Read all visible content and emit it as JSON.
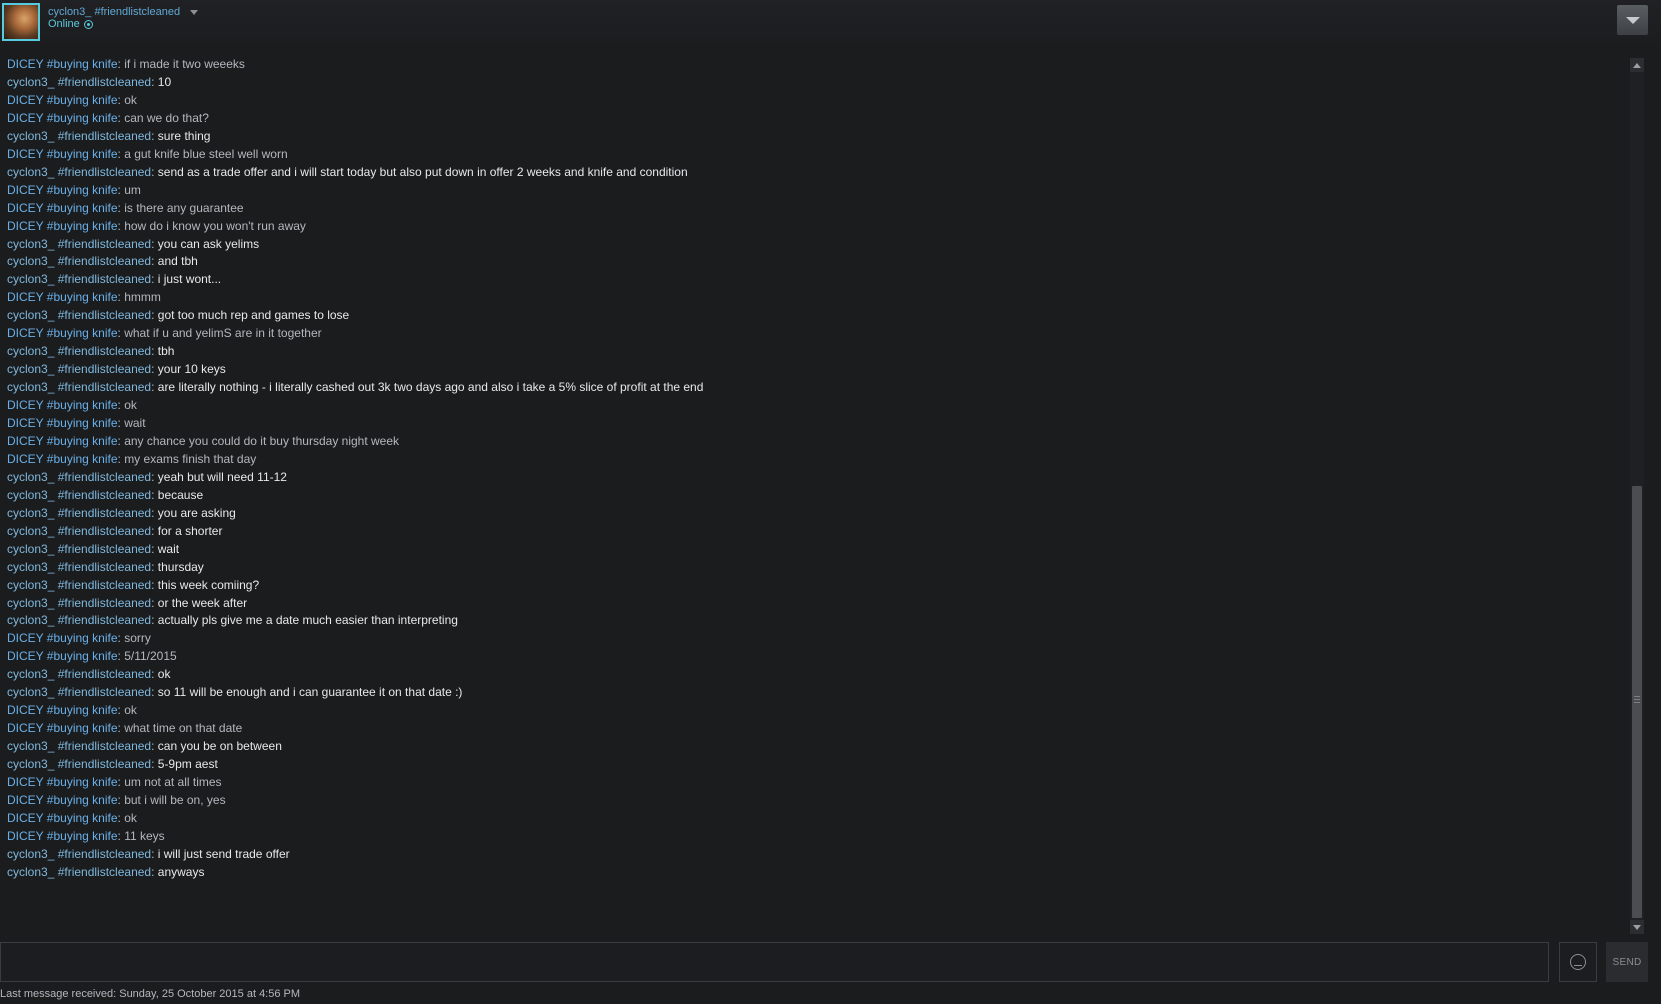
{
  "header": {
    "username": "cyclon3_ #friendlistcleaned",
    "status": "Online"
  },
  "chat": {
    "messages": [
      {
        "nick": "DICEY #buying knife",
        "text": "if i made it two weeeks"
      },
      {
        "nick": "cyclon3_ #friendlistcleaned",
        "text": "10"
      },
      {
        "nick": "DICEY #buying knife",
        "text": "ok"
      },
      {
        "nick": "DICEY #buying knife",
        "text": "can we do that?"
      },
      {
        "nick": "cyclon3_ #friendlistcleaned",
        "text": "sure thing"
      },
      {
        "nick": "DICEY #buying knife",
        "text": "a gut knife blue steel well worn"
      },
      {
        "nick": "cyclon3_ #friendlistcleaned",
        "text": "send as a trade offer and i will start today but also put down in offer 2 weeks and knife and condition"
      },
      {
        "nick": "DICEY #buying knife",
        "text": "um"
      },
      {
        "nick": "DICEY #buying knife",
        "text": "is there any guarantee"
      },
      {
        "nick": "DICEY #buying knife",
        "text": "how do i know you won't run away"
      },
      {
        "nick": "cyclon3_ #friendlistcleaned",
        "text": "you can ask yelims"
      },
      {
        "nick": "cyclon3_ #friendlistcleaned",
        "text": "and tbh"
      },
      {
        "nick": "cyclon3_ #friendlistcleaned",
        "text": "i just wont..."
      },
      {
        "nick": "DICEY #buying knife",
        "text": "hmmm"
      },
      {
        "nick": "cyclon3_ #friendlistcleaned",
        "text": "got too much rep and games to lose"
      },
      {
        "nick": "DICEY #buying knife",
        "text": "what if u and yelimS are in it together"
      },
      {
        "nick": "cyclon3_ #friendlistcleaned",
        "text": "tbh"
      },
      {
        "nick": "cyclon3_ #friendlistcleaned",
        "text": "your 10 keys"
      },
      {
        "nick": "cyclon3_ #friendlistcleaned",
        "text": "are literally nothing - i literally cashed out 3k two days ago and also i take a 5% slice of profit at the end"
      },
      {
        "nick": "DICEY #buying knife",
        "text": "ok"
      },
      {
        "nick": "DICEY #buying knife",
        "text": "wait"
      },
      {
        "nick": "DICEY #buying knife",
        "text": "any chance you could do it buy thursday night week"
      },
      {
        "nick": "DICEY #buying knife",
        "text": "my exams finish that day"
      },
      {
        "nick": "cyclon3_ #friendlistcleaned",
        "text": "yeah but will need 11-12"
      },
      {
        "nick": "cyclon3_ #friendlistcleaned",
        "text": "because"
      },
      {
        "nick": "cyclon3_ #friendlistcleaned",
        "text": "you are asking"
      },
      {
        "nick": "cyclon3_ #friendlistcleaned",
        "text": "for a shorter"
      },
      {
        "nick": "cyclon3_ #friendlistcleaned",
        "text": "wait"
      },
      {
        "nick": "cyclon3_ #friendlistcleaned",
        "text": "thursday"
      },
      {
        "nick": "cyclon3_ #friendlistcleaned",
        "text": "this week comiing?"
      },
      {
        "nick": "cyclon3_ #friendlistcleaned",
        "text": "or the week after"
      },
      {
        "nick": "cyclon3_ #friendlistcleaned",
        "text": "actually pls give me a date much easier than interpreting"
      },
      {
        "nick": "DICEY #buying knife",
        "text": "sorry"
      },
      {
        "nick": "DICEY #buying knife",
        "text": "5/11/2015"
      },
      {
        "nick": "cyclon3_ #friendlistcleaned",
        "text": "ok"
      },
      {
        "nick": "cyclon3_ #friendlistcleaned",
        "text": "so 11 will be enough and i can guarantee it on that date :)"
      },
      {
        "nick": "DICEY #buying knife",
        "text": "ok"
      },
      {
        "nick": "DICEY #buying knife",
        "text": "what time on that date"
      },
      {
        "nick": "cyclon3_ #friendlistcleaned",
        "text": "can you be on between"
      },
      {
        "nick": "cyclon3_ #friendlistcleaned",
        "text": "5-9pm aest"
      },
      {
        "nick": "DICEY #buying knife",
        "text": "um not at all times"
      },
      {
        "nick": "DICEY #buying knife",
        "text": "but i will be on, yes"
      },
      {
        "nick": "DICEY #buying knife",
        "text": "ok"
      },
      {
        "nick": "DICEY #buying knife",
        "text": "11 keys"
      },
      {
        "nick": "cyclon3_ #friendlistcleaned",
        "text": "i will just send trade offer"
      },
      {
        "nick": "cyclon3_ #friendlistcleaned",
        "text": "anyways"
      }
    ]
  },
  "footer": {
    "send_label": "SEND",
    "last_message": "Last message received: Sunday, 25 October 2015 at 4:56 PM"
  },
  "colors": {
    "background": "#1b1c1e",
    "nick": "#6ab0e8",
    "self_text": "#e7e9eb",
    "other_text": "#b3b8bd"
  }
}
